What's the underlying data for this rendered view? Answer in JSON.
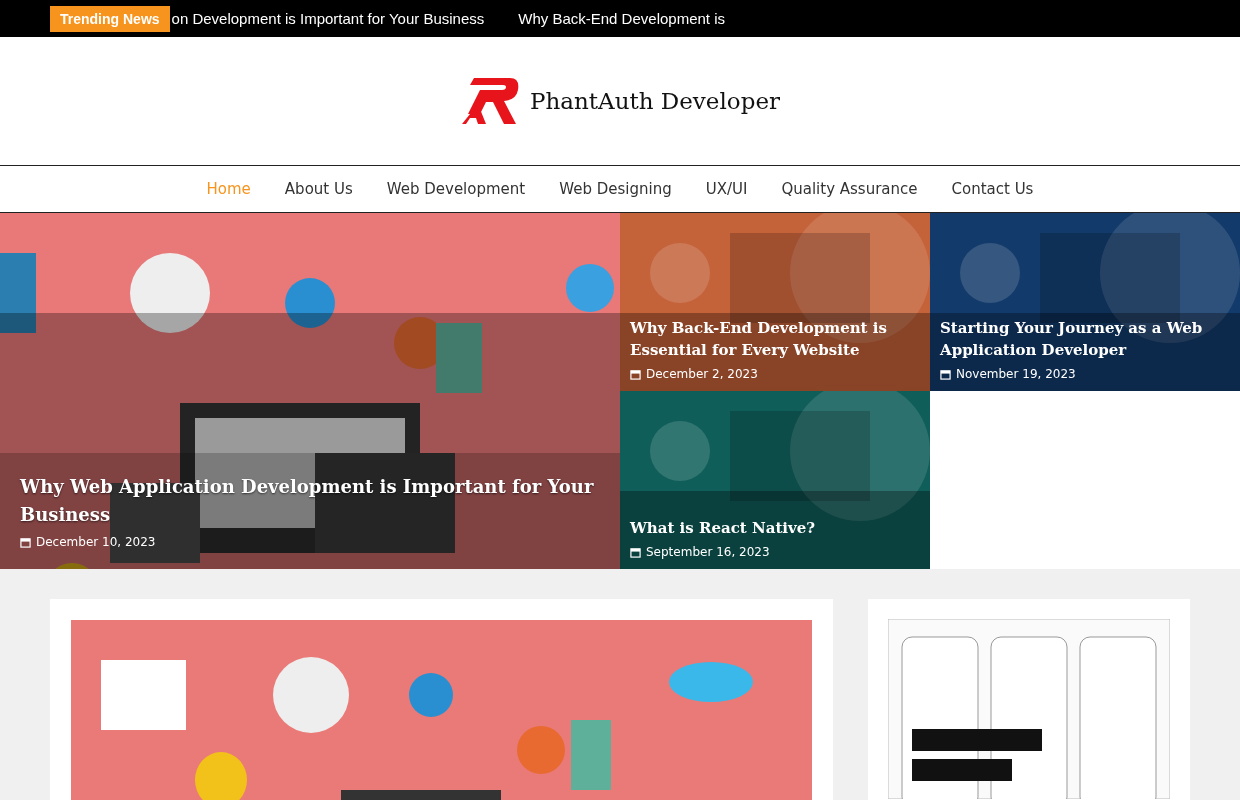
{
  "top_bar": {
    "badge": "Trending News",
    "ticker": [
      "on Development is Important for Your Business",
      "Why Back-End Development is"
    ]
  },
  "logo": {
    "text": "PhantAuth Developer"
  },
  "nav": [
    {
      "label": "Home",
      "selected": true
    },
    {
      "label": "About Us",
      "selected": false
    },
    {
      "label": "Web Development",
      "selected": false
    },
    {
      "label": "Web Designing",
      "selected": false
    },
    {
      "label": "UX/UI",
      "selected": false
    },
    {
      "label": "Quality Assurance",
      "selected": false
    },
    {
      "label": "Contact Us",
      "selected": false
    }
  ],
  "featured": {
    "title": "Why Web Application Development is Important for Your Business",
    "date": "December 10, 2023"
  },
  "posts": [
    {
      "title": "Why Back-End Development is Essential for Every Website",
      "date": "December 2, 2023",
      "color": "#c4623a"
    },
    {
      "title": "Starting Your Journey as a Web Application Developer",
      "date": "November 19, 2023",
      "color": "#123a6a"
    },
    {
      "title": "What is React Native?",
      "date": "September 16, 2023",
      "color": "#0f5e5a"
    }
  ]
}
